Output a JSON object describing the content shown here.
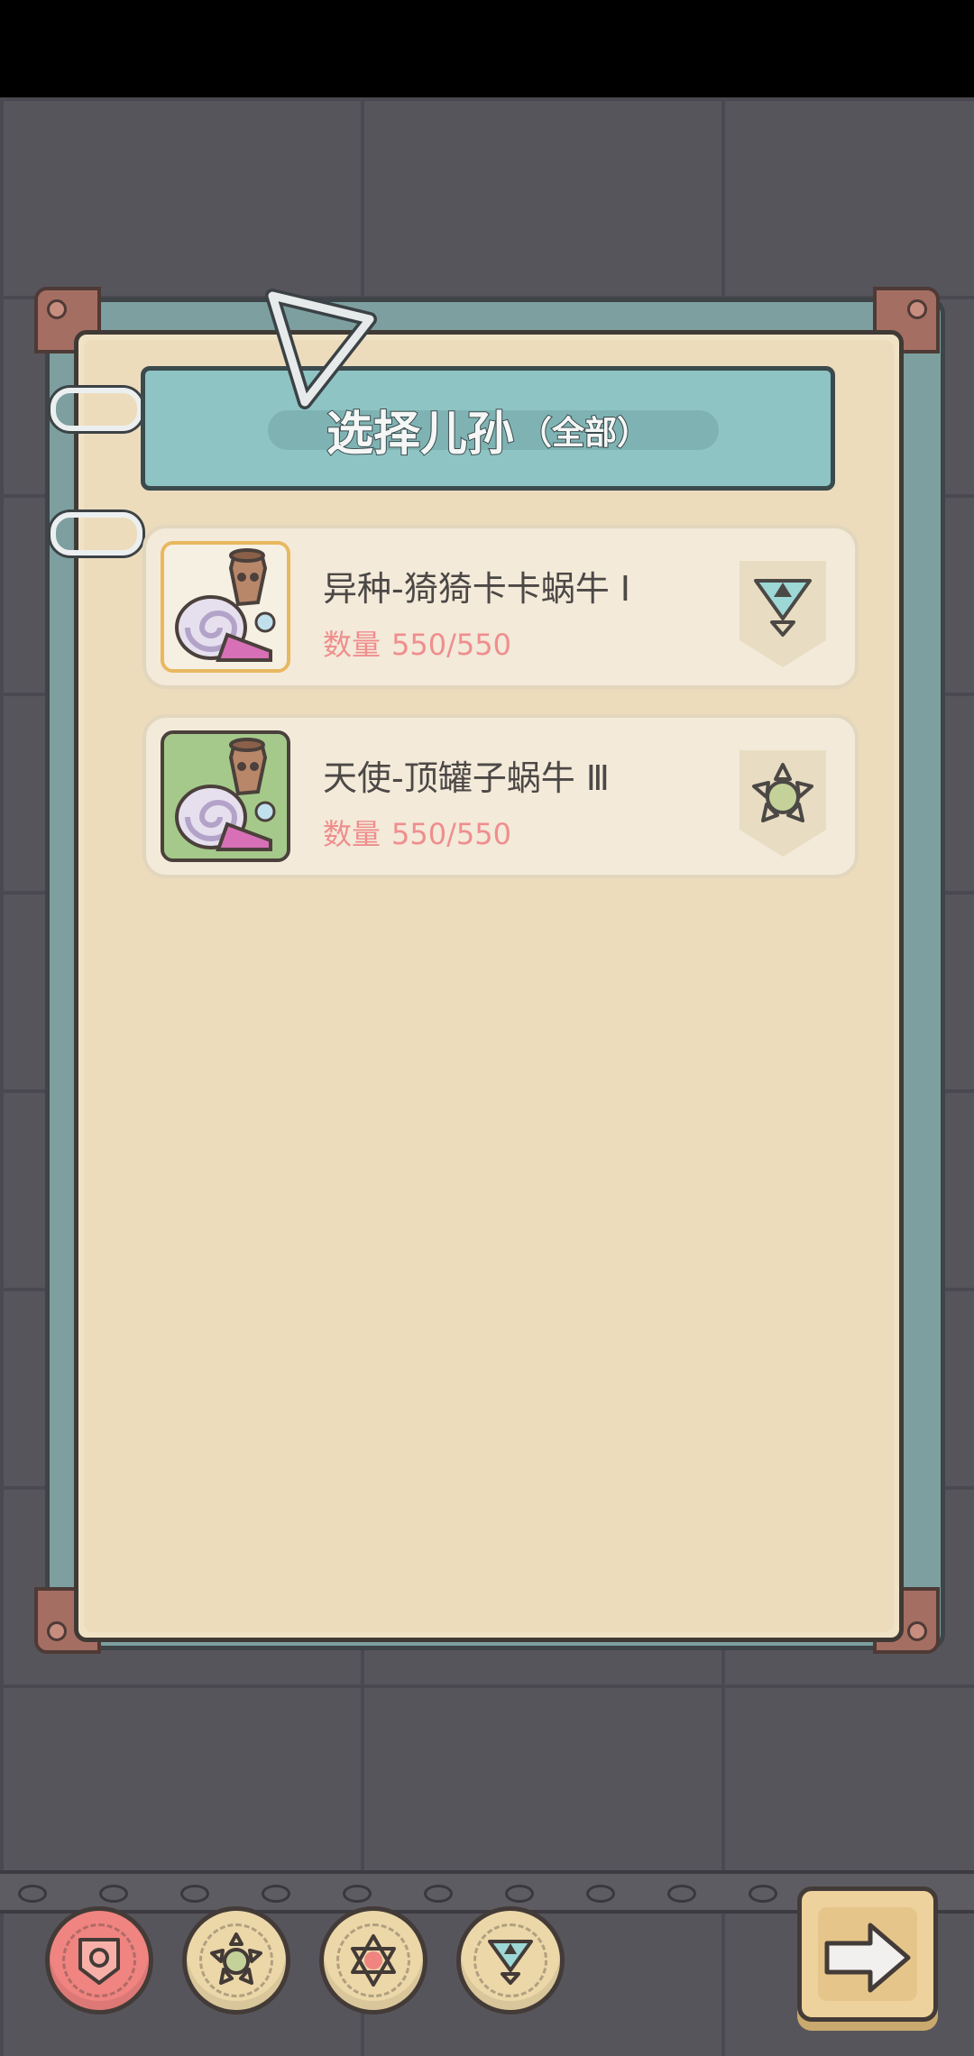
{
  "header": {
    "title": "选择儿孙",
    "subtitle": "（全部）"
  },
  "list": [
    {
      "name": "异种-猗猗卡卡蜗牛 Ⅰ",
      "qty_label": "数量",
      "qty_value": "550/550",
      "badge_icon": "triangle-rank-icon",
      "thumb_bg": "#f6f0e3",
      "thumb_border": "#e8c070"
    },
    {
      "name": "天使-顶罐子蜗牛 Ⅲ",
      "qty_label": "数量",
      "qty_value": "550/550",
      "badge_icon": "flower-rank-icon",
      "thumb_bg": "#a5c98a",
      "thumb_border": "#4b403b"
    }
  ],
  "filters": [
    {
      "icon": "shield-filter-icon",
      "active": true
    },
    {
      "icon": "flower-filter-icon",
      "active": false
    },
    {
      "icon": "star-filter-icon",
      "active": false
    },
    {
      "icon": "triangle-filter-icon",
      "active": false
    }
  ],
  "next": {
    "icon": "arrow-right-icon"
  },
  "colors": {
    "accent_teal": "#8ec4c4",
    "paper": "#ecdcbc",
    "qty_pink": "#ef8e8e",
    "active_filter": "#ef8480"
  }
}
